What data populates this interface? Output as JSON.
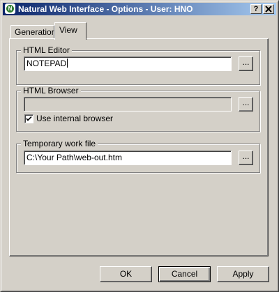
{
  "window": {
    "title": "Natural Web Interface - Options - User: HNO",
    "help_label": "?",
    "close_label": "✕"
  },
  "tabs": [
    {
      "label": "Generation",
      "active": false
    },
    {
      "label": "View",
      "active": true
    }
  ],
  "html_editor": {
    "group_label": "HTML Editor",
    "value": "NOTEPAD",
    "browse_label": "..."
  },
  "html_browser": {
    "group_label": "HTML Browser",
    "value": "",
    "browse_label": "...",
    "use_internal_label": "Use internal browser",
    "use_internal_checked": true
  },
  "temp_file": {
    "group_label": "Temporary work file",
    "value": "C:\\Your Path\\web-out.htm",
    "browse_label": "..."
  },
  "buttons": {
    "ok": "OK",
    "cancel": "Cancel",
    "apply": "Apply"
  }
}
